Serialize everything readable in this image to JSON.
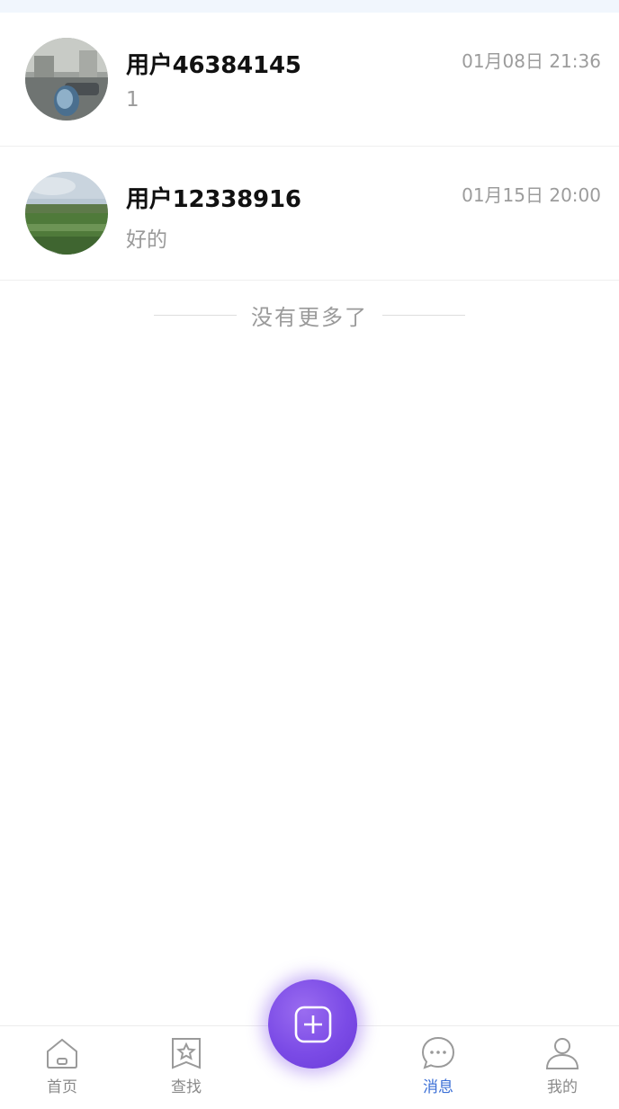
{
  "messages": [
    {
      "username": "用户46384145",
      "preview": "1",
      "time": "01月08日 21:36",
      "avatar": "rainy-car-mirror-photo"
    },
    {
      "username": "用户12338916",
      "preview": "好的",
      "time": "01月15日 20:00",
      "avatar": "field-landscape-photo"
    }
  ],
  "list_end_text": "没有更多了",
  "tabbar": {
    "home": {
      "label": "首页",
      "icon": "home-icon"
    },
    "find": {
      "label": "查找",
      "icon": "star-bookmark-icon"
    },
    "add": {
      "icon": "plus-icon"
    },
    "messages": {
      "label": "消息",
      "icon": "chat-bubble-icon",
      "active": true
    },
    "mine": {
      "label": "我的",
      "icon": "person-icon"
    }
  },
  "colors": {
    "accent": "#3b6fd6",
    "fab": "#7b4be6",
    "topbar": "#f1f6fd"
  }
}
